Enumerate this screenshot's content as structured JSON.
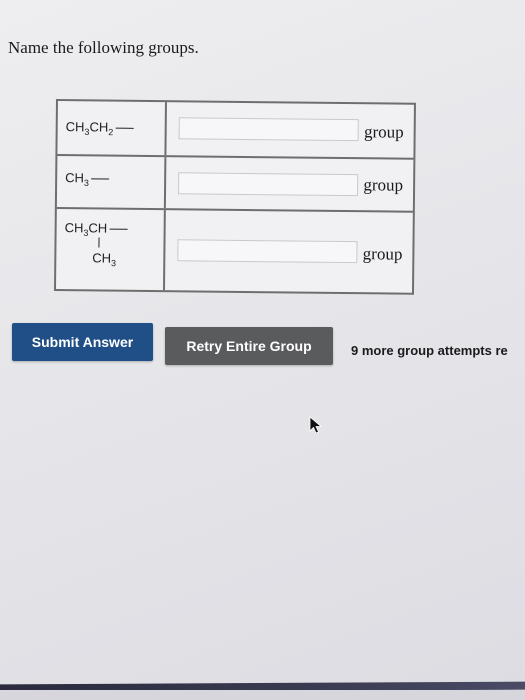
{
  "question": {
    "prompt": "Name the following groups."
  },
  "rows": [
    {
      "formula_main": "CH",
      "formula_sub1": "3",
      "formula_mid": "CH",
      "formula_sub2": "2",
      "input_value": "",
      "suffix": "group"
    },
    {
      "formula_main": "CH",
      "formula_sub1": "3",
      "input_value": "",
      "suffix": "group"
    },
    {
      "formula_main": "CH",
      "formula_sub1": "3",
      "formula_mid": "CH",
      "branch_main": "CH",
      "branch_sub": "3",
      "input_value": "",
      "suffix": "group"
    }
  ],
  "actions": {
    "submit_label": "Submit Answer",
    "retry_label": "Retry Entire Group",
    "submit_color": "#1f4f86",
    "retry_color": "#5a5b5d"
  },
  "status": {
    "attempts_text": "9 more group attempts re"
  }
}
